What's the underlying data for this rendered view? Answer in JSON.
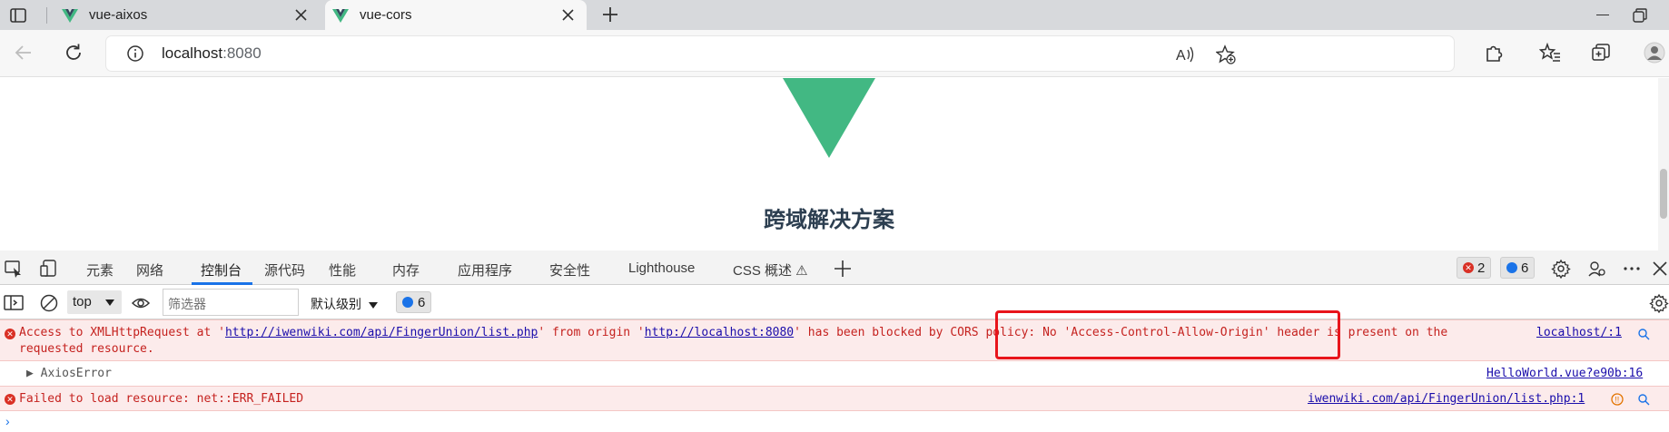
{
  "browser": {
    "tabs": [
      {
        "title": "vue-aixos",
        "active": false
      },
      {
        "title": "vue-cors",
        "active": true
      }
    ],
    "address": {
      "host": "localhost",
      "port": ":8080"
    }
  },
  "page": {
    "heading": "跨域解决方案"
  },
  "devtools": {
    "tabs": [
      "元素",
      "网络",
      "控制台",
      "源代码",
      "性能",
      "内存",
      "应用程序",
      "安全性",
      "Lighthouse",
      "CSS 概述 ⚠"
    ],
    "error_count": "2",
    "message_count": "6",
    "console": {
      "context": "top",
      "filter_placeholder": "筛选器",
      "level": "默认级别",
      "issues_count": "6"
    },
    "messages": [
      {
        "type": "error",
        "line1_pre": "Access to XMLHttpRequest at '",
        "url1": "http://iwenwiki.com/api/FingerUnion/list.php",
        "line1_mid": "' from origin '",
        "url2": "http://localhost:8080",
        "line1_post": "' has been blocked by CORS policy: No 'Access-Control-Allow-Origin' header is present on the",
        "line2": "requested resource.",
        "source": "localhost/:1"
      },
      {
        "type": "info",
        "text": "▶ AxiosError",
        "source": "HelloWorld.vue?e90b:16"
      },
      {
        "type": "error",
        "text": "Failed to load resource: net::ERR_FAILED",
        "source": "iwenwiki.com/api/FingerUnion/list.php:1"
      }
    ]
  },
  "colors": {
    "vue_green": "#42b883",
    "error_red": "#d93025",
    "highlight_red": "#e8141b",
    "link_blue": "#1a0dab"
  }
}
